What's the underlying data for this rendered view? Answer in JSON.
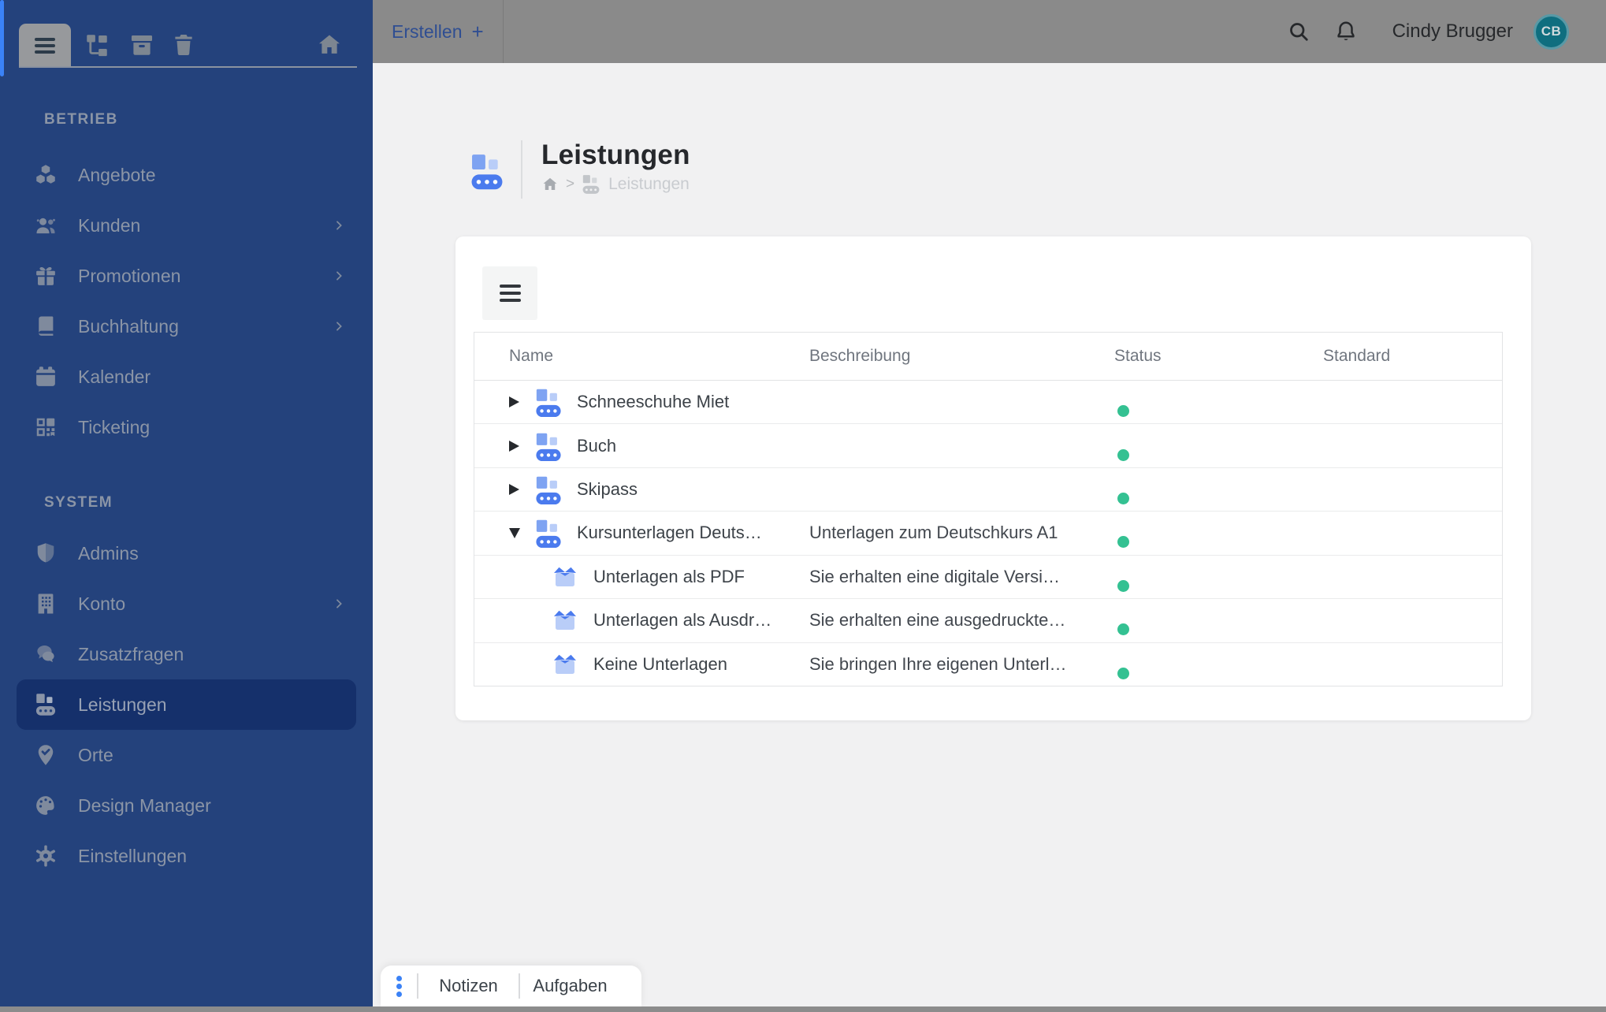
{
  "colors": {
    "sidebar-bg": "#24427c",
    "sidebar-muted": "#8b95a6",
    "sidebar-active-bg": "#15306b",
    "accent-blue": "#3b82f6",
    "topbar-bg": "#8a8a8a",
    "create-blue": "#2f4e92",
    "page-bg": "#f1f1f2",
    "card-bg": "#ffffff",
    "icon-blue": "#4b7bee",
    "icon-blue-mid": "#7ea3f2",
    "icon-blue-light": "#b9cdf8",
    "status-green": "#34c192",
    "status-green-ring": "#b2e7d0",
    "avatar-teal": "#0f6e7f",
    "avatar-ring": "#5899a6",
    "table-border": "#e2e3e5",
    "header-text": "#70767f",
    "cell-text": "#3c4248",
    "breadcrumb": "#9aa0a6",
    "title": "#26282c"
  },
  "topbar": {
    "create_label": "Erstellen",
    "create_plus": "+",
    "user_name": "Cindy Brugger",
    "avatar_initials": "CB"
  },
  "sidebar": {
    "sections": [
      {
        "label": "BETRIEB",
        "items": [
          {
            "label": "Angebote"
          },
          {
            "label": "Kunden",
            "chevron": true
          },
          {
            "label": "Promotionen",
            "chevron": true
          },
          {
            "label": "Buchhaltung",
            "chevron": true
          },
          {
            "label": "Kalender"
          },
          {
            "label": "Ticketing"
          }
        ]
      },
      {
        "label": "SYSTEM",
        "items": [
          {
            "label": "Admins"
          },
          {
            "label": "Konto",
            "chevron": true
          },
          {
            "label": "Zusatzfragen"
          },
          {
            "label": "Leistungen",
            "active": true
          },
          {
            "label": "Orte"
          },
          {
            "label": "Design Manager"
          },
          {
            "label": "Einstellungen"
          }
        ]
      }
    ]
  },
  "page": {
    "title": "Leistungen",
    "breadcrumb": {
      "current": "Leistungen"
    }
  },
  "table": {
    "columns": {
      "name": "Name",
      "description": "Beschreibung",
      "status": "Status",
      "standard": "Standard"
    },
    "rows": [
      {
        "name": "Schneeschuhe Miet",
        "description": "",
        "status": "active"
      },
      {
        "name": "Buch",
        "description": "",
        "status": "active"
      },
      {
        "name": "Skipass",
        "description": "",
        "status": "active"
      },
      {
        "name": "Kursunterlagen Deuts…",
        "description": "Unterlagen zum Deutschkurs A1",
        "status": "active",
        "expanded": true
      },
      {
        "name": "Unterlagen als PDF",
        "description": "Sie erhalten eine digitale Versi…",
        "status": "active",
        "child": true
      },
      {
        "name": "Unterlagen als Ausdr…",
        "description": "Sie erhalten eine ausgedruckte…",
        "status": "active",
        "child": true
      },
      {
        "name": "Keine Unterlagen",
        "description": "Sie bringen Ihre eigenen Unterl…",
        "status": "active",
        "child": true
      }
    ]
  },
  "bottom_panel": {
    "tabs": [
      {
        "label": "Notizen"
      },
      {
        "label": "Aufgaben"
      }
    ]
  }
}
